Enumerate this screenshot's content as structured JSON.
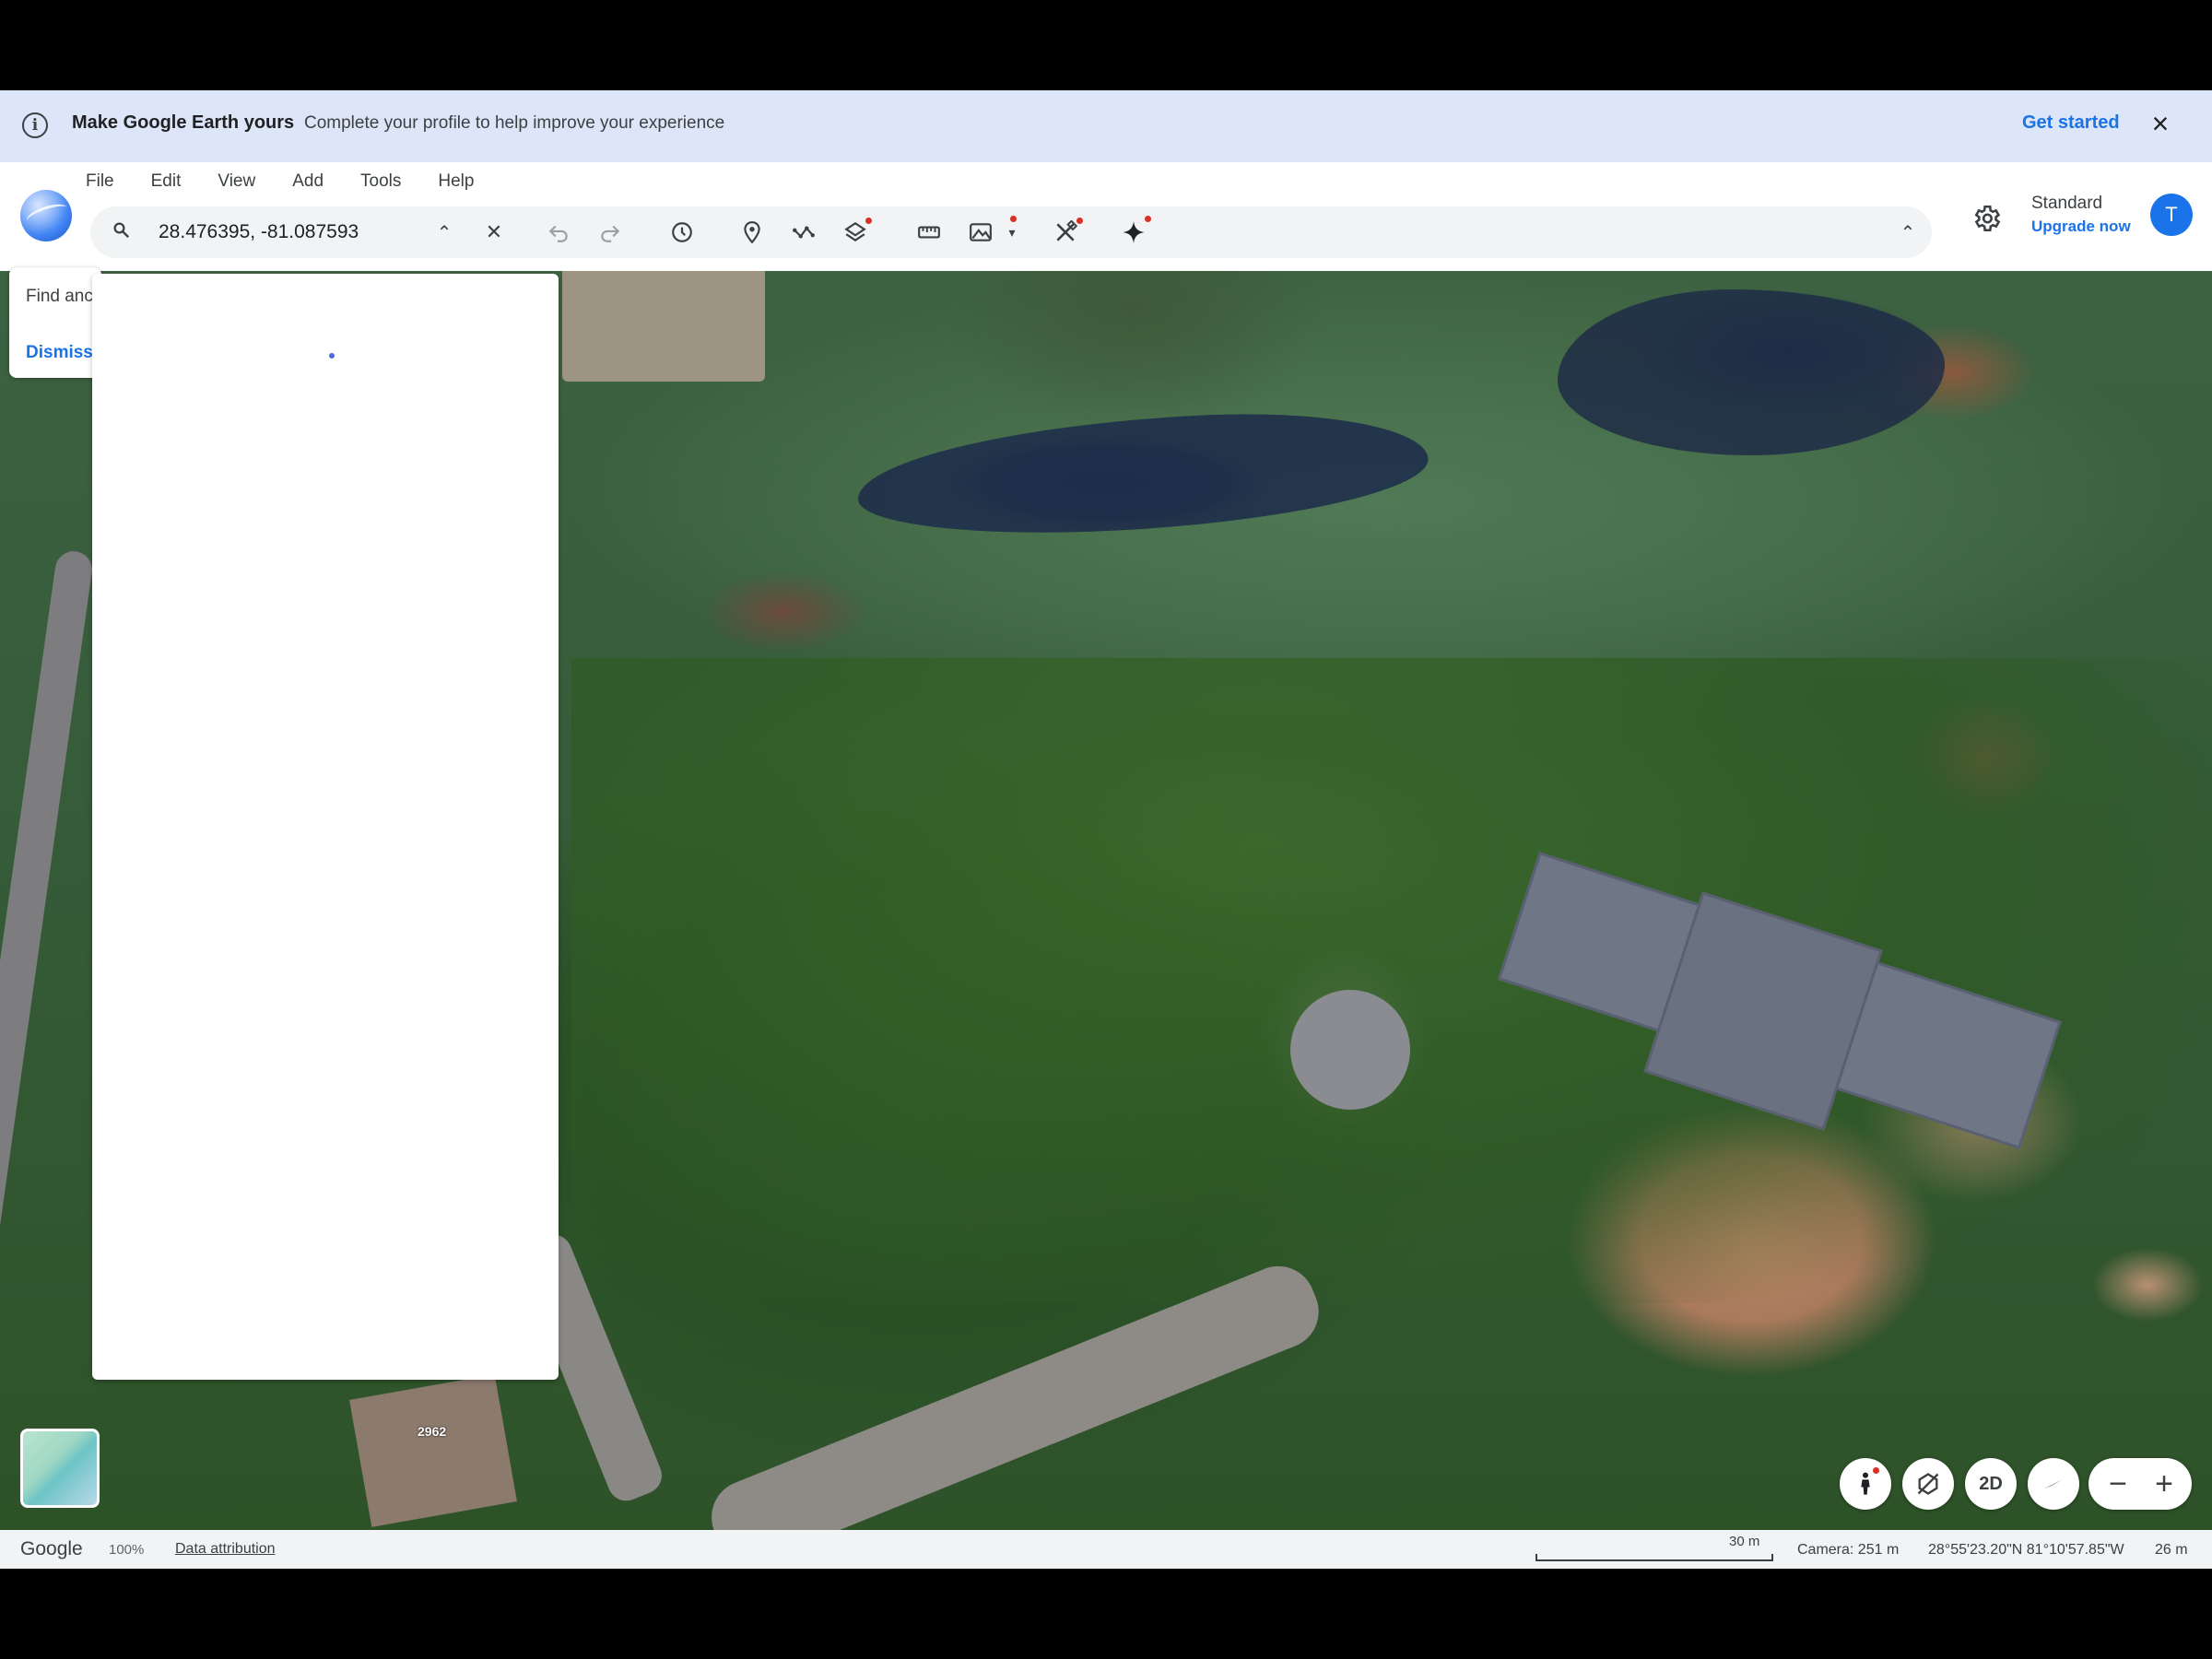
{
  "banner": {
    "title": "Make Google Earth yours",
    "text": "Complete your profile to help improve your experience",
    "cta": "Get started",
    "close_icon": "close-icon"
  },
  "menu": [
    "File",
    "Edit",
    "View",
    "Add",
    "Tools",
    "Help"
  ],
  "search": {
    "value": "28.476395, -81.087593",
    "clear_symbol": "✕"
  },
  "toolbar_icons": [
    "undo-icon",
    "redo-icon",
    "historical-imagery-icon",
    "add-placemark-icon",
    "add-path-icon",
    "layers-icon",
    "measure-icon",
    "elevation-icon",
    "tools-icon",
    "gemini-icon",
    "collapse-icon"
  ],
  "account": {
    "plan": "Standard",
    "upgrade": "Upgrade now",
    "avatar_letter": "T"
  },
  "tip": {
    "text": "Find anc",
    "dismiss": "Dismiss"
  },
  "map_labels": {
    "house_number": "2962"
  },
  "controls": {
    "view_2d": "2D"
  },
  "status": {
    "brand": "Google",
    "zoom": "100%",
    "attribution": "Data attribution",
    "scale": "30 m",
    "camera": "Camera: 251 m",
    "coordinates": "28°55'23.20\"N 81°10'57.85\"W",
    "elevation": "26 m"
  },
  "colors": {
    "accent": "#1a73e8",
    "banner_bg": "#dde6f8",
    "notification_dot": "#d93025"
  }
}
